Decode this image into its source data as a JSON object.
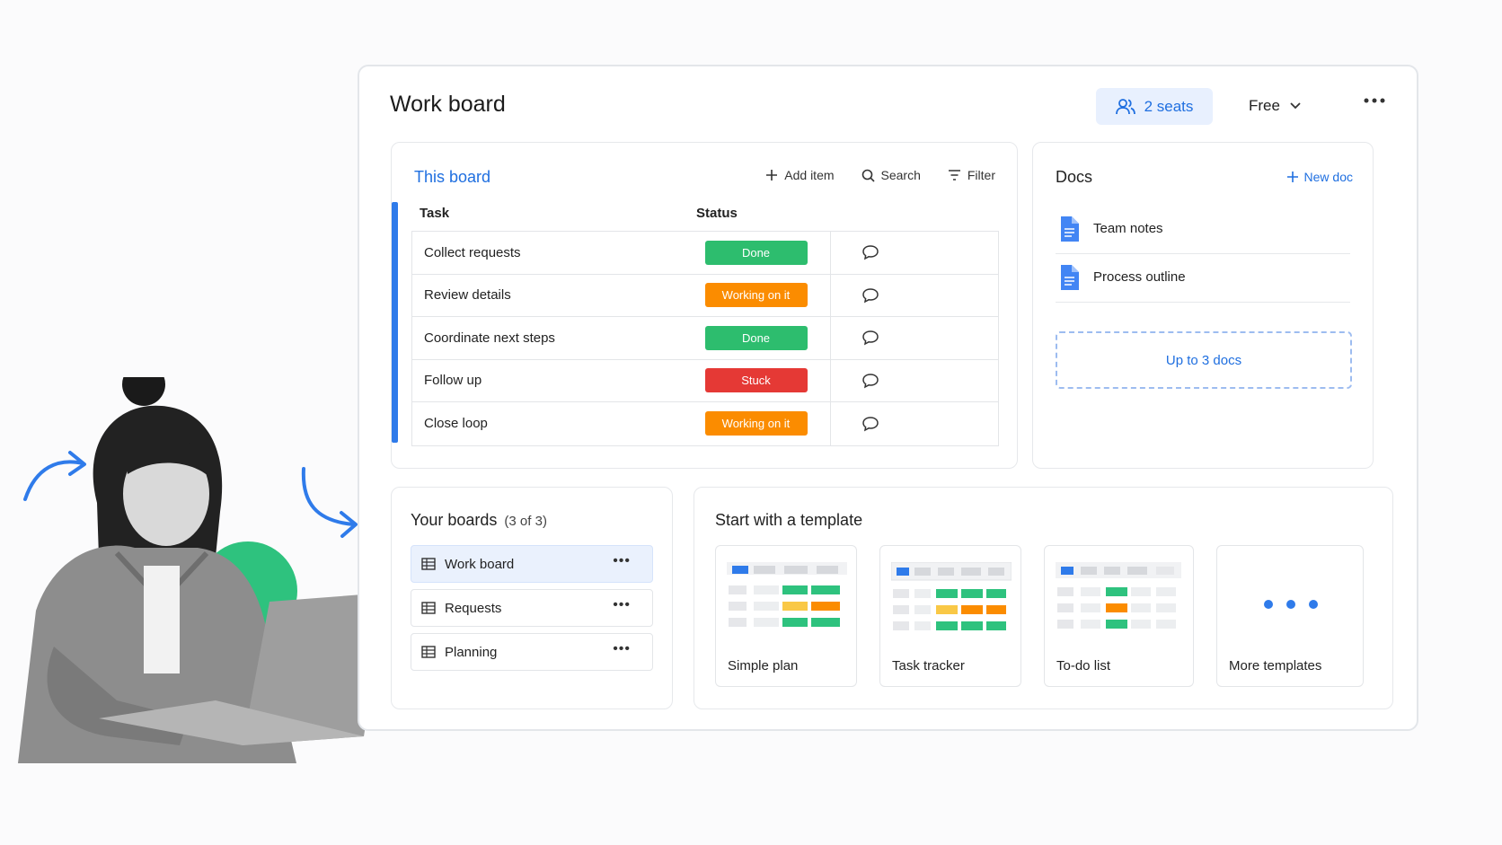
{
  "header": {
    "title": "Work board",
    "seats_label": "2 seats",
    "plan_label": "Free"
  },
  "board": {
    "title": "This board",
    "toolbar": {
      "add_item": "Add item",
      "search": "Search",
      "filter": "Filter"
    },
    "columns": {
      "task": "Task",
      "status": "Status"
    },
    "rows": [
      {
        "task": "Collect requests",
        "status": "Done",
        "status_color": "#2dbd6e"
      },
      {
        "task": "Review details",
        "status": "Working on it",
        "status_color": "#fb8c00"
      },
      {
        "task": "Coordinate next steps",
        "status": "Done",
        "status_color": "#2dbd6e"
      },
      {
        "task": "Follow up",
        "status": "Stuck",
        "status_color": "#e53935"
      },
      {
        "task": "Close loop",
        "status": "Working on it",
        "status_color": "#fb8c00"
      }
    ]
  },
  "docs": {
    "title": "Docs",
    "new_doc": "New doc",
    "items": [
      "Team notes",
      "Process outline"
    ],
    "limit": "Up to 3 docs"
  },
  "your_boards": {
    "title": "Your boards",
    "count": "(3 of 3)",
    "items": [
      "Work board",
      "Requests",
      "Planning"
    ]
  },
  "templates": {
    "title": "Start with a template",
    "cards": [
      "Simple plan",
      "Task tracker",
      "To-do list",
      "More templates"
    ]
  },
  "colors": {
    "accent": "#1f6fe0",
    "done": "#2dbd6e",
    "working": "#fb8c00",
    "stuck": "#e53935",
    "doc_icon": "#4285f4"
  },
  "icons": [
    "people-icon",
    "chevron-down-icon",
    "more-icon",
    "plus-icon",
    "search-icon",
    "filter-icon",
    "comment-icon",
    "doc-icon",
    "board-grid-icon",
    "arrow-icon",
    "squiggle-icon"
  ]
}
